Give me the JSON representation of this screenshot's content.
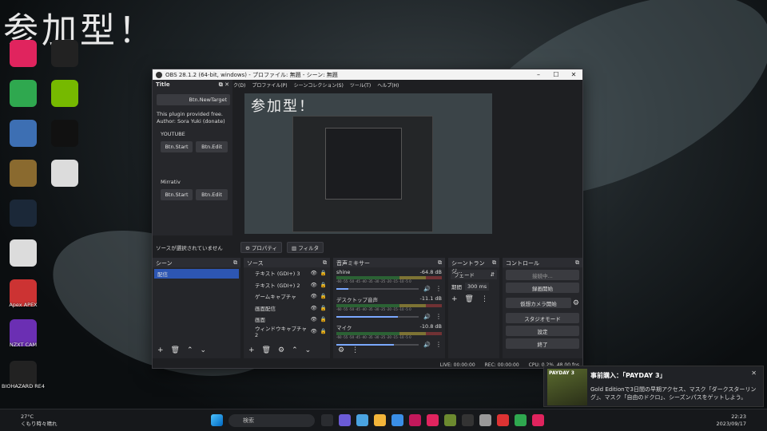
{
  "overlay_title": "参加型！",
  "desktop_icons": [
    {
      "label": "",
      "icon": "music-app-icon",
      "color": "#e0245e"
    },
    {
      "label": "",
      "icon": "obs-icon",
      "color": "#222"
    },
    {
      "label": "",
      "icon": "green-app-icon",
      "color": "#2fa84f"
    },
    {
      "label": "",
      "icon": "nvidia-icon",
      "color": "#76b900"
    },
    {
      "label": "",
      "icon": "recycle-bin-icon",
      "color": "#3d6fb3"
    },
    {
      "label": "",
      "icon": "logitech-icon",
      "color": "#111"
    },
    {
      "label": "",
      "icon": "game-icon",
      "color": "#8a6a2f"
    },
    {
      "label": "",
      "icon": "file-icon",
      "color": "#dcdcdc"
    },
    {
      "label": "",
      "icon": "steam-icon",
      "color": "#1b2838"
    },
    {
      "label": "",
      "icon": "file-icon",
      "color": "#dcdcdc"
    },
    {
      "label": "Apex APEX",
      "icon": "apex-icon",
      "color": "#c33"
    },
    {
      "label": "NZXT CAM",
      "icon": "nzxt-icon",
      "color": "#6b2fb3"
    },
    {
      "label": "BIOHAZARD RE4",
      "icon": "re4-icon",
      "color": "#222"
    }
  ],
  "obs": {
    "title": "OBS 28.1.2 (64-bit, windows) - プロファイル: 無題 - シーン: 無題",
    "menu": [
      "ック(D)",
      "プロファイル(P)",
      "シーンコレクション(S)",
      "ツール(T)",
      "ヘルプ(H)"
    ],
    "plugin_dock": {
      "title": "Title",
      "new_target": "Btn.NewTarget",
      "info_line1": "This plugin provided free.",
      "info_line2": "Author: Sora Yuki (donate)",
      "groups": [
        {
          "name": "YOUTUBE",
          "start": "Btn.Start",
          "edit": "Btn.Edit"
        },
        {
          "name": "Mirrativ",
          "start": "Btn.Start",
          "edit": "Btn.Edit"
        }
      ]
    },
    "no_source_selected": "ソースが選択されていません",
    "properties_btn": "プロパティ",
    "filters_btn": "フィルタ",
    "scenes": {
      "title": "シーン",
      "items": [
        "配信"
      ]
    },
    "sources": {
      "title": "ソース",
      "items": [
        "テキスト (GDI+) 3",
        "テキスト (GDI+) 2",
        "ゲームキャプチャ",
        "画面配信",
        "画面",
        "ウィンドウキャプチャ 2"
      ]
    },
    "mixer": {
      "title": "音声ミキサー",
      "channels": [
        {
          "name": "shine",
          "db": "-64.8 dB",
          "level": 0.15
        },
        {
          "name": "デスクトップ音声",
          "db": "-11.1 dB",
          "level": 0.75
        },
        {
          "name": "マイク",
          "db": "-10.8 dB",
          "level": 0.7
        }
      ],
      "scale": "-60 -55 -50 -45 -40 -35 -30 -25 -20 -15 -10 -5 0"
    },
    "transitions": {
      "title": "シーントランジ...",
      "type": "フェード",
      "duration_label": "期間",
      "duration": "300 ms"
    },
    "controls": {
      "title": "コントロール",
      "buttons": [
        "接続中...",
        "録画開始",
        "仮想カメラ開始",
        "スタジオモード",
        "設定",
        "終了"
      ]
    },
    "status": {
      "live": "LIVE: 00:00:00",
      "rec": "REC: 00:00:00",
      "cpu": "CPU: 0.2%, 48.00 fps"
    }
  },
  "notification": {
    "title": "事前購入：「PAYDAY 3」",
    "body": "Gold Editionで3日間の早期アクセス、マスク「ダークスターリング」、マスク「自由のドクロ」、シーズンパスをゲットしよう。",
    "game": "PAYDAY 3"
  },
  "taskbar": {
    "weather_temp": "27°C",
    "weather_desc": "くもり時々晴れ",
    "search_placeholder": "検索",
    "time": "22:23",
    "date": "2023/09/17"
  }
}
